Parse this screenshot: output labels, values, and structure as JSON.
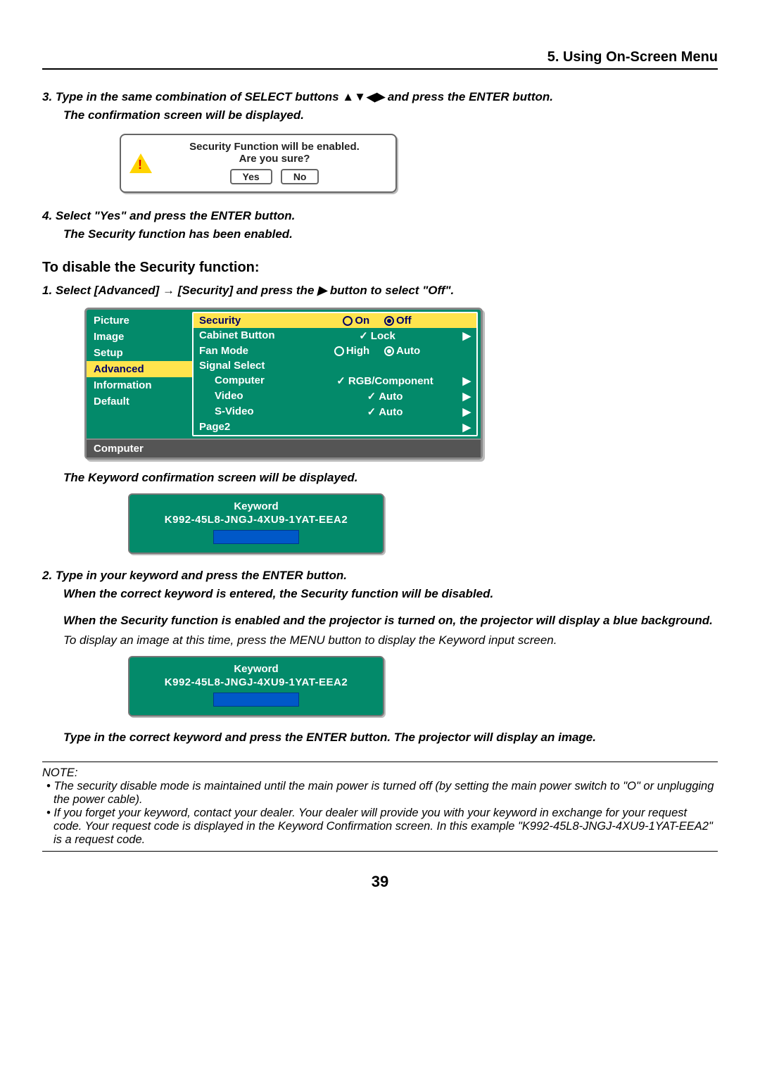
{
  "chapter": "5. Using On-Screen Menu",
  "step3": "3.  Type in the same combination of SELECT buttons ▲▼◀▶ and press the ENTER button.",
  "step3b": "The confirmation screen will be displayed.",
  "confirm": {
    "line1": "Security Function will be enabled.",
    "line2": "Are you sure?",
    "yes": "Yes",
    "no": "No"
  },
  "step4": "4.  Select \"Yes\" and press the ENTER button.",
  "step4b": "The Security function has been enabled.",
  "disable_heading": "To disable the Security function:",
  "disable_step1": "1.  Select [Advanced] → [Security] and press the ▶ button to select \"Off\".",
  "osd": {
    "left": [
      "Picture",
      "Image",
      "Setup",
      "Advanced",
      "Information",
      "Default"
    ],
    "left_selected_index": 3,
    "rows": [
      {
        "label": "Security",
        "val_left": "On",
        "val_right": "Off",
        "hl": true,
        "radio": true,
        "sel": "right"
      },
      {
        "label": "Cabinet Button",
        "val_center": "Lock",
        "chev": true,
        "check": true
      },
      {
        "label": "Fan Mode",
        "val_left": "High",
        "val_right": "Auto",
        "radio": true,
        "sel": "right"
      },
      {
        "label": "Signal Select"
      },
      {
        "label": "Computer",
        "val_center": "RGB/Component",
        "chev": true,
        "check": true,
        "sub": true
      },
      {
        "label": "Video",
        "val_center": "Auto",
        "chev": true,
        "check": true,
        "sub": true
      },
      {
        "label": "S-Video",
        "val_center": "Auto",
        "chev": true,
        "check": true,
        "sub": true
      },
      {
        "label": "Page2",
        "chev": true
      }
    ],
    "footer": "Computer"
  },
  "kw_line": "The Keyword confirmation screen will be displayed.",
  "kw": {
    "title": "Keyword",
    "code": "K992-45L8-JNGJ-4XU9-1YAT-EEA2"
  },
  "disable_step2a": "2.  Type in your keyword and press the ENTER button.",
  "disable_step2b": "When the correct keyword is entered, the Security function will be disabled.",
  "blue_bg_a": "When the Security function is enabled and the projector is turned on, the projector will display a blue background.",
  "blue_bg_b": "To display an image at this time, press the MENU button to display the Keyword input screen.",
  "type_correct": "Type in the correct keyword and press the ENTER button. The projector will display an image.",
  "note": {
    "label": "NOTE:",
    "item1": "• The security disable mode is maintained until the main power is turned off (by setting the main power switch to \"O\" or unplugging the power cable).",
    "item2": "• If you forget your keyword, contact your dealer. Your dealer will provide you with your keyword in exchange for your request code. Your request code is displayed in the Keyword Confirmation screen. In this example \"K992-45L8-JNGJ-4XU9-1YAT-EEA2\" is a request code."
  },
  "page_number": "39"
}
